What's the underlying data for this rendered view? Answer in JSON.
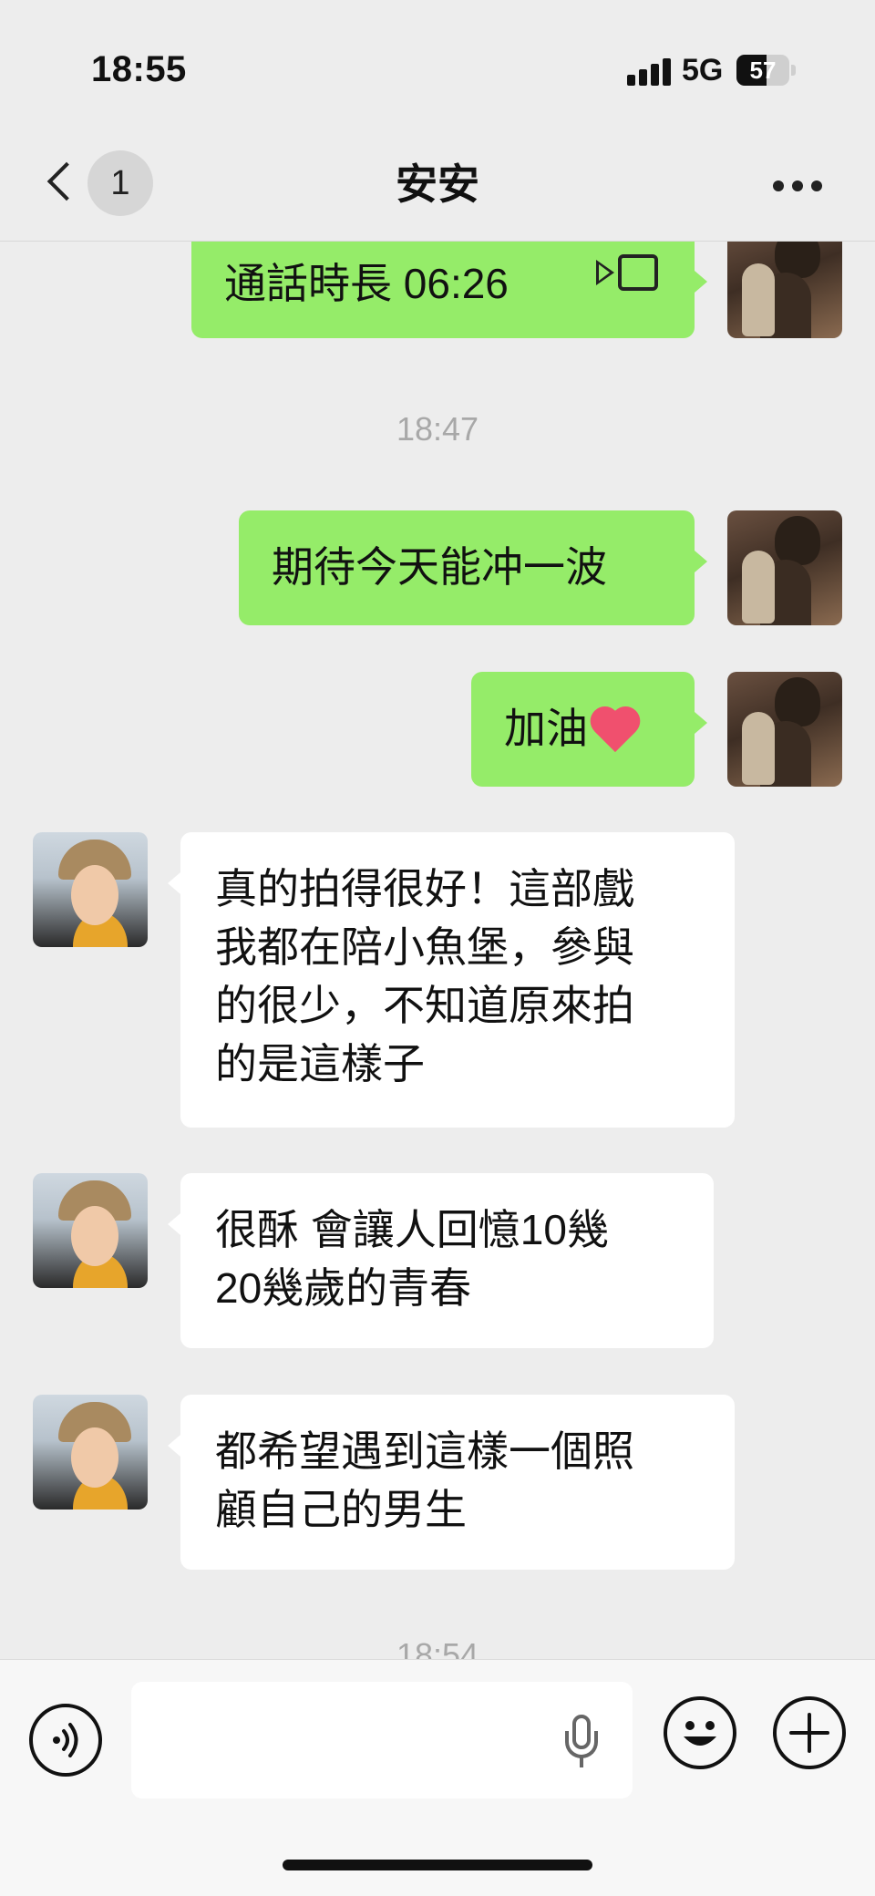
{
  "status_bar": {
    "time": "18:55",
    "network": "5G",
    "battery": "57",
    "battery_level": 0.57
  },
  "nav": {
    "back_badge": "1",
    "title": "安安"
  },
  "messages": [
    {
      "sender": "me",
      "type": "call",
      "text": "通話時長 06:26"
    },
    {
      "type": "timestamp",
      "text": "18:47"
    },
    {
      "sender": "me",
      "text": "期待今天能冲一波"
    },
    {
      "sender": "me",
      "text": "加油",
      "emoji": "heart"
    },
    {
      "sender": "contact",
      "lines": [
        "真的拍得很好！這部戲",
        "我都在陪小魚堡，參與",
        "的很少，不知道原來拍",
        "的是這樣子"
      ]
    },
    {
      "sender": "contact",
      "lines": [
        "很酥 會讓人回憶10幾",
        "20幾歲的青春"
      ]
    },
    {
      "sender": "contact",
      "lines": [
        "都希望遇到這樣一個照",
        "顧自己的男生"
      ]
    },
    {
      "type": "timestamp",
      "text": "18:54"
    }
  ],
  "icons": {
    "back": "chevron-left-icon",
    "more": "more-dots-icon",
    "video_call": "video-camera-icon",
    "voice": "voice-wave-icon",
    "mic": "microphone-icon",
    "emoji": "smiley-icon",
    "plus": "plus-icon"
  },
  "colors": {
    "sent_bubble": "#95ec69",
    "received_bubble": "#ffffff",
    "background": "#ededed"
  }
}
